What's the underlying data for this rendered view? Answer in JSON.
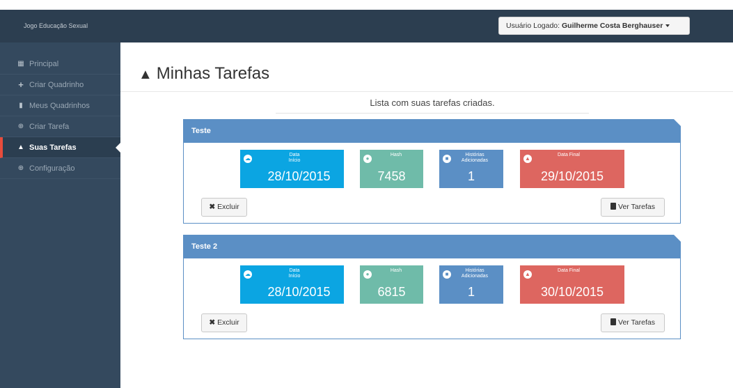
{
  "header": {
    "brand": "Jogo Educação Sexual",
    "user_prefix": "Usuário Logado: ",
    "user_name": "Guilherme Costa Berghauser"
  },
  "sidebar": {
    "items": [
      {
        "label": "Principal",
        "icon": "grid-icon"
      },
      {
        "label": "Criar Quadrinho",
        "icon": "plus-icon"
      },
      {
        "label": "Meus Quadrinhos",
        "icon": "file-icon"
      },
      {
        "label": "Criar Tarefa",
        "icon": "plus-circle-icon"
      },
      {
        "label": "Suas Tarefas",
        "icon": "graduation-cap-icon",
        "active": true
      },
      {
        "label": "Configuração",
        "icon": "plus-circle-icon"
      }
    ]
  },
  "main": {
    "title": "Minhas Tarefas",
    "subtitle": "Lista com suas tarefas criadas.",
    "tasks": [
      {
        "name": "Teste",
        "start_label": "Data Início",
        "start": "28/10/2015",
        "hash_label": "Hash",
        "hash": "7458",
        "stories_label": "Histórias Adicionadas",
        "stories": "1",
        "end_label": "Data Final",
        "end": "29/10/2015",
        "delete_label": "Excluir",
        "view_label": "Ver Tarefas"
      },
      {
        "name": "Teste 2",
        "start_label": "Data Início",
        "start": "28/10/2015",
        "hash_label": "Hash",
        "hash": "6815",
        "stories_label": "Histórias Adicionadas",
        "stories": "1",
        "end_label": "Data Final",
        "end": "30/10/2015",
        "delete_label": "Excluir",
        "view_label": "Ver Tarefas"
      }
    ]
  },
  "colors": {
    "topbar": "#2c3e50",
    "sidebar": "#34495e",
    "panel": "#5b8fc5",
    "tile_start": "#0ba5e2",
    "tile_hash": "#6fbba9",
    "tile_stories": "#5b8fc5",
    "tile_end": "#dd6660",
    "active_marker": "#e74c3c"
  }
}
